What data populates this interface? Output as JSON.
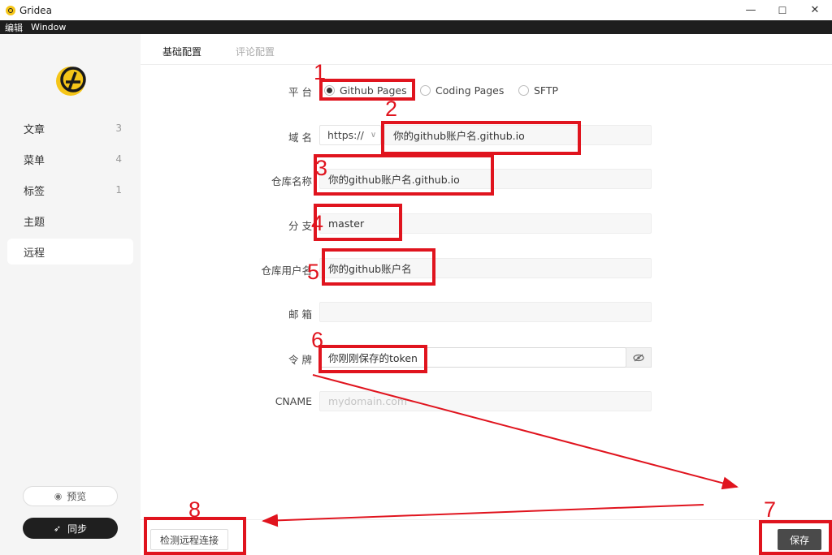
{
  "window": {
    "title": "Gridea",
    "minimize": "—",
    "maximize": "☐",
    "close": "✕"
  },
  "menu": [
    "编辑",
    "Window"
  ],
  "sidebar": {
    "items": [
      {
        "label": "文章",
        "count": "3"
      },
      {
        "label": "菜单",
        "count": "4"
      },
      {
        "label": "标签",
        "count": "1"
      },
      {
        "label": "主题",
        "count": ""
      },
      {
        "label": "远程",
        "count": ""
      }
    ],
    "preview_label": "预览",
    "sync_label": "同步"
  },
  "tabs": [
    "基础配置",
    "评论配置"
  ],
  "form": {
    "platform_label": "平 台",
    "platforms": [
      "Github Pages",
      "Coding Pages",
      "SFTP"
    ],
    "domain_label": "域 名",
    "protocol": "https://",
    "domain_value": "你的github账户名.github.io",
    "repo_label": "仓库名称",
    "repo_value": "你的github账户名.github.io",
    "branch_label": "分 支",
    "branch_value": "master",
    "user_label": "仓库用户名",
    "user_value": "你的github账户名",
    "email_label": "邮 箱",
    "email_value": "",
    "token_label": "令 牌",
    "token_value": "你刚刚保存的token",
    "cname_label": "CNAME",
    "cname_placeholder": "mydomain.com"
  },
  "footer": {
    "check_label": "检测远程连接",
    "save_label": "保存"
  },
  "annotations": [
    "1",
    "2",
    "3",
    "4",
    "5",
    "6",
    "7",
    "8"
  ],
  "colors": {
    "highlight": "#e0141e",
    "logo": "#f5c518",
    "sidebar_bg": "#f5f5f5",
    "save_bg": "#4a4a4a"
  }
}
